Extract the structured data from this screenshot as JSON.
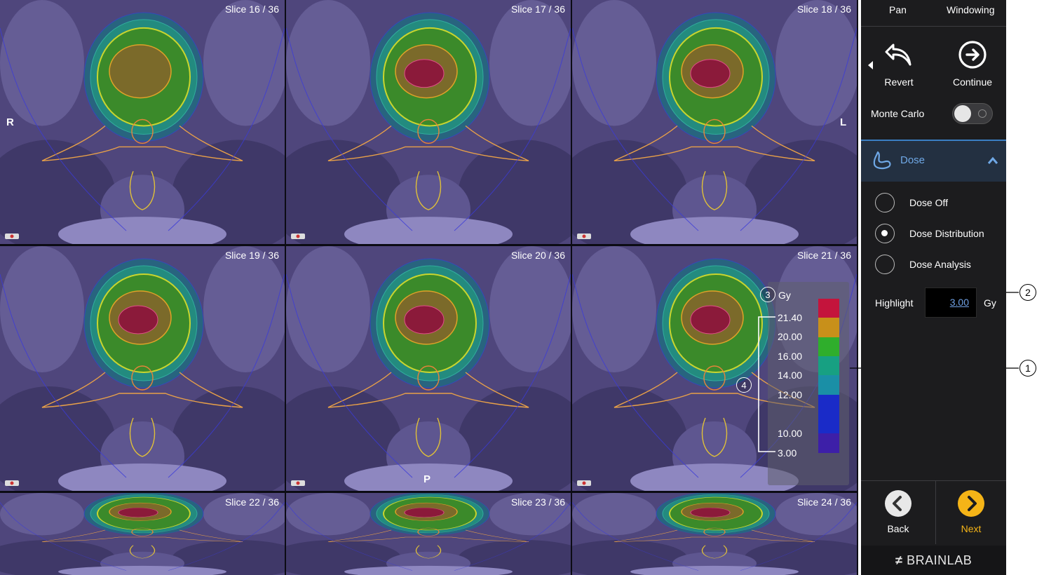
{
  "viewer": {
    "slices": [
      {
        "label": "Slice 16 / 36"
      },
      {
        "label": "Slice 17 / 36"
      },
      {
        "label": "Slice 18 / 36"
      },
      {
        "label": "Slice 19 / 36"
      },
      {
        "label": "Slice 20 / 36"
      },
      {
        "label": "Slice 21 / 36"
      },
      {
        "label": "Slice 22 / 36"
      },
      {
        "label": "Slice 23 / 36"
      },
      {
        "label": "Slice 24 / 36"
      }
    ],
    "orientation": {
      "right": "R",
      "left": "L",
      "posterior": "P"
    },
    "legend": {
      "unit": "Gy",
      "ticks": [
        "21.40",
        "20.00",
        "16.00",
        "14.00",
        "12.00",
        "10.00",
        "3.00"
      ],
      "colors": [
        "#c4143c",
        "#c8901a",
        "#2fae2c",
        "#17a082",
        "#1a8fa6",
        "#1a2bc8",
        "#3d1fa8"
      ]
    },
    "callouts": {
      "one": "1",
      "two": "2",
      "three": "3",
      "four": "4"
    }
  },
  "panel": {
    "pan_label": "Pan",
    "windowing_label": "Windowing",
    "revert_label": "Revert",
    "continue_label": "Continue",
    "monte_carlo_label": "Monte Carlo",
    "dose_title": "Dose",
    "dose_off_label": "Dose Off",
    "dose_distribution_label": "Dose Distribution",
    "dose_analysis_label": "Dose Analysis",
    "highlight_label": "Highlight",
    "highlight_value": "3.00",
    "highlight_unit": "Gy",
    "back_label": "Back",
    "next_label": "Next",
    "brand": "BRAINLAB"
  },
  "colors": {
    "accent_blue": "#3a7fc3",
    "next_yellow": "#f5b417"
  }
}
